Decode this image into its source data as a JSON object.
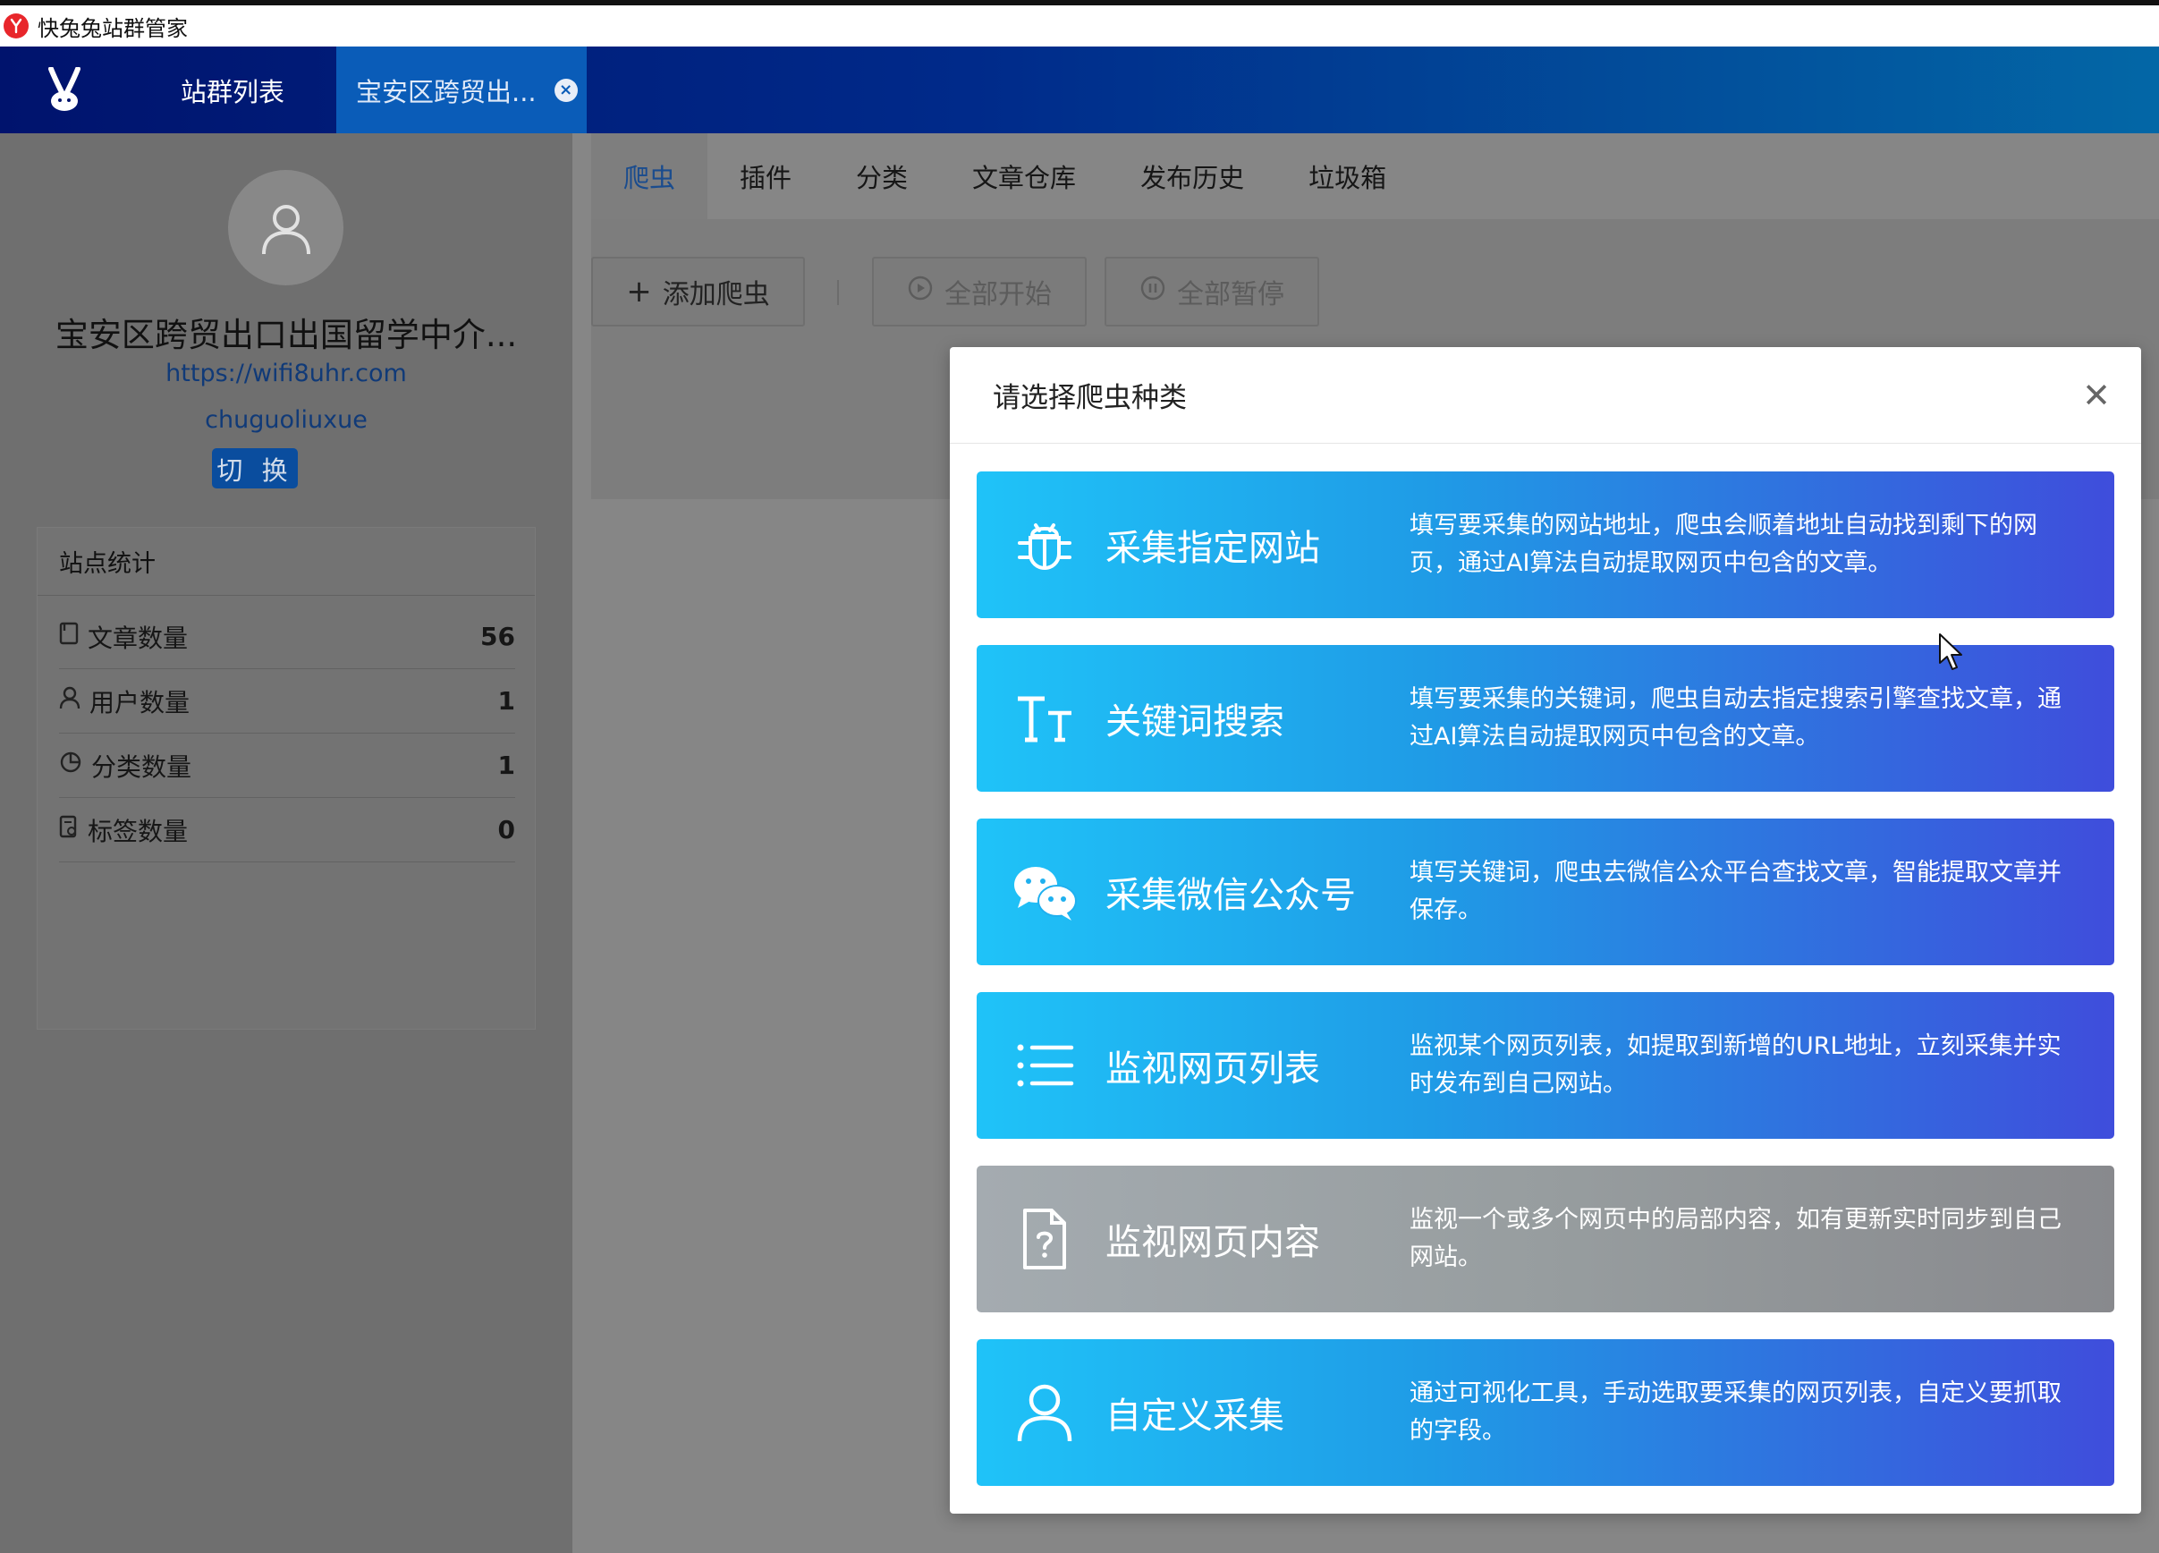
{
  "window": {
    "title": "快兔兔站群管家"
  },
  "appbar": {
    "tabs": [
      {
        "label": "站群列表"
      },
      {
        "label": "宝安区跨贸出..."
      }
    ]
  },
  "sidebar": {
    "site_name": "宝安区跨贸出口出国留学中介...",
    "site_url": "https://wifi8uhr.com",
    "site_user": "chuguoliuxue",
    "switch_label": "切 换",
    "stats": {
      "title": "站点统计",
      "rows": [
        {
          "label": "文章数量",
          "value": "56",
          "icon": "document-icon"
        },
        {
          "label": "用户数量",
          "value": "1",
          "icon": "user-icon"
        },
        {
          "label": "分类数量",
          "value": "1",
          "icon": "pie-chart-icon"
        },
        {
          "label": "标签数量",
          "value": "0",
          "icon": "tag-icon"
        }
      ]
    }
  },
  "main": {
    "tabs": [
      {
        "label": "爬虫",
        "active": true
      },
      {
        "label": "插件"
      },
      {
        "label": "分类"
      },
      {
        "label": "文章仓库"
      },
      {
        "label": "发布历史"
      },
      {
        "label": "垃圾箱"
      }
    ],
    "toolbar": {
      "add_label": "添加爬虫",
      "start_all_label": "全部开始",
      "pause_all_label": "全部暂停"
    }
  },
  "modal": {
    "title": "请选择爬虫种类",
    "cards": [
      {
        "name": "采集指定网站",
        "icon": "bug-icon",
        "desc": "填写要采集的网站地址，爬虫会顺着地址自动找到剩下的网页，通过AI算法自动提取网页中包含的文章。"
      },
      {
        "name": "关键词搜索",
        "icon": "text-size-icon",
        "desc": "填写要采集的关键词，爬虫自动去指定搜索引擎查找文章，通过AI算法自动提取网页中包含的文章。"
      },
      {
        "name": "采集微信公众号",
        "icon": "wechat-icon",
        "desc": "填写关键词，爬虫去微信公众平台查找文章，智能提取文章并保存。"
      },
      {
        "name": "监视网页列表",
        "icon": "list-icon",
        "desc": "监视某个网页列表，如提取到新增的URL地址，立刻采集并实时发布到自己网站。"
      },
      {
        "name": "监视网页内容",
        "icon": "question-file-icon",
        "desc": "监视一个或多个网页中的局部内容，如有更新实时同步到自己网站。"
      },
      {
        "name": "自定义采集",
        "icon": "user-icon",
        "desc": "通过可视化工具，手动选取要采集的网页列表，自定义要抓取的字段。"
      }
    ]
  },
  "colors": {
    "appbar_start": "#00136d",
    "appbar_end": "#0367a6",
    "card_gradient_start": "#1fc3f8",
    "card_gradient_end": "#3f4ddc",
    "disabled_card": "#979d9f"
  }
}
